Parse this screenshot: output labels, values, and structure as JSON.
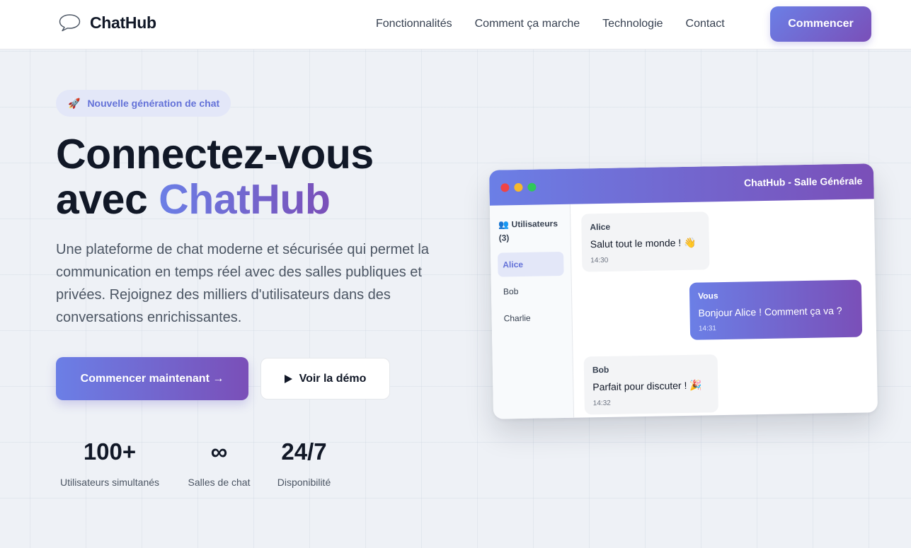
{
  "nav": {
    "brand": "ChatHub",
    "links": [
      "Fonctionnalités",
      "Comment ça marche",
      "Technologie",
      "Contact"
    ],
    "cta": "Commencer"
  },
  "hero": {
    "badge_icon": "🚀",
    "badge": "Nouvelle génération de chat",
    "title_line1": "Connectez-vous",
    "title_line2_prefix": "avec ",
    "title_line2_accent": "ChatHub",
    "description": "Une plateforme de chat moderne et sécurisée qui permet la communication en temps réel avec des salles publiques et privées. Rejoignez des milliers d'utilisateurs dans des conversations enrichissantes.",
    "primary_button": "Commencer maintenant →",
    "secondary_button": "Voir la démo",
    "stats": [
      {
        "value": "100+",
        "label": "Utilisateurs simultanés"
      },
      {
        "value": "∞",
        "label": "Salles de chat"
      },
      {
        "value": "24/7",
        "label": "Disponibilité"
      }
    ]
  },
  "mockup": {
    "title": "ChatHub - Salle Générale",
    "users_title": "👥 Utilisateurs (3)",
    "users": [
      "Alice",
      "Bob",
      "Charlie"
    ],
    "messages": [
      {
        "author": "Alice",
        "text": "Salut tout le monde ! 👋",
        "time": "14:30"
      },
      {
        "author": "Vous",
        "text": "Bonjour Alice ! Comment ça va ?",
        "time": "14:31"
      },
      {
        "author": "Bob",
        "text": "Parfait pour discuter ! 🎉",
        "time": "14:32"
      }
    ]
  },
  "colors": {
    "accent_start": "#6b7fe6",
    "accent_end": "#7a4fb8",
    "dot_red": "#ef4444",
    "dot_yellow": "#f5b82e",
    "dot_green": "#2fc85a"
  }
}
